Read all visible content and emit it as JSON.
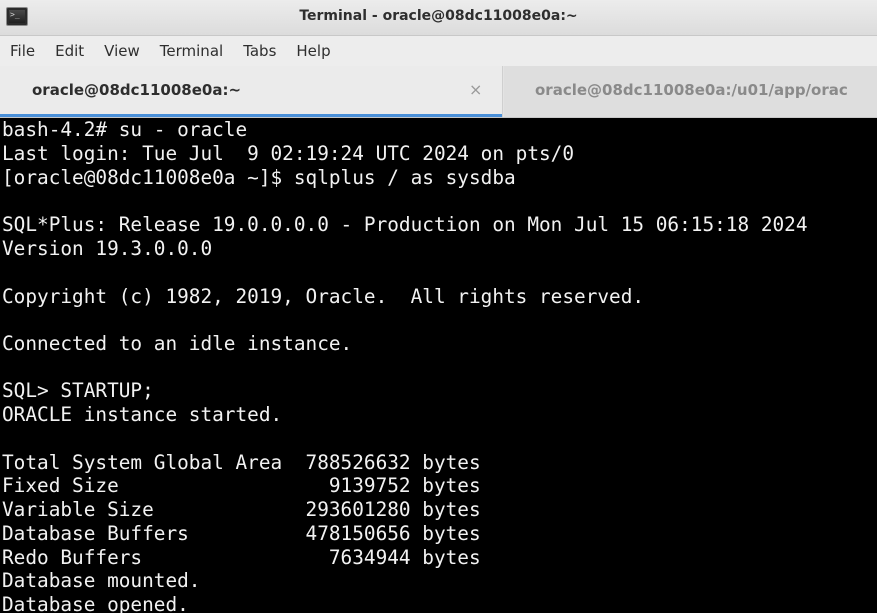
{
  "window": {
    "title": "Terminal - oracle@08dc11008e0a:~",
    "icon": "terminal-app-icon"
  },
  "menu": {
    "items": [
      {
        "label": "File"
      },
      {
        "label": "Edit"
      },
      {
        "label": "View"
      },
      {
        "label": "Terminal"
      },
      {
        "label": "Tabs"
      },
      {
        "label": "Help"
      }
    ]
  },
  "tabs": [
    {
      "label": "oracle@08dc11008e0a:~",
      "active": true,
      "close_glyph": "×"
    },
    {
      "label": "oracle@08dc11008e0a:/u01/app/orac",
      "active": false
    }
  ],
  "terminal": {
    "background": "#000000",
    "foreground": "#f2f2f2",
    "lines": [
      "bash-4.2# su - oracle",
      "Last login: Tue Jul  9 02:19:24 UTC 2024 on pts/0",
      "[oracle@08dc11008e0a ~]$ sqlplus / as sysdba",
      "",
      "SQL*Plus: Release 19.0.0.0.0 - Production on Mon Jul 15 06:15:18 2024",
      "Version 19.3.0.0.0",
      "",
      "Copyright (c) 1982, 2019, Oracle.  All rights reserved.",
      "",
      "Connected to an idle instance.",
      "",
      "SQL> STARTUP;",
      "ORACLE instance started.",
      "",
      "Total System Global Area  788526632 bytes",
      "Fixed Size                  9139752 bytes",
      "Variable Size             293601280 bytes",
      "Database Buffers          478150656 bytes",
      "Redo Buffers                7634944 bytes",
      "Database mounted.",
      "Database opened."
    ]
  },
  "colors": {
    "tab_active_underline": "#4a90d9",
    "chrome": "#ededed"
  }
}
